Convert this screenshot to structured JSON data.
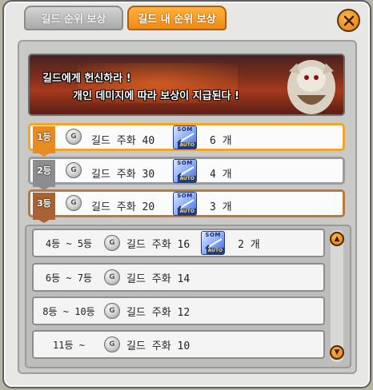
{
  "tabs": [
    {
      "label": "길드 순위 보상",
      "active": false
    },
    {
      "label": "길드 내 순위 보상",
      "active": true
    }
  ],
  "close_icon": "close-icon",
  "banner": {
    "line1": "길드에게 헌신하라 !",
    "line2": "개인 데미지에 따라 보상이 지급된다 !"
  },
  "top_ranks": [
    {
      "rank": "1등",
      "item": "길드 주화 40",
      "ticket_top": "SOM",
      "ticket_auto": "AUTO",
      "count": "6 개",
      "style": "gold"
    },
    {
      "rank": "2등",
      "item": "길드 주화 30",
      "ticket_top": "SOM",
      "ticket_auto": "AUTO",
      "count": "4 개",
      "style": "silver"
    },
    {
      "rank": "3등",
      "item": "길드 주화 20",
      "ticket_top": "SOM",
      "ticket_auto": "AUTO",
      "count": "3 개",
      "style": "bronze"
    }
  ],
  "list_ranks": [
    {
      "rank": "4등 ~ 5등",
      "item": "길드 주화 16",
      "ticket_top": "SOM",
      "ticket_auto": "AUTO",
      "count": "2 개"
    },
    {
      "rank": "6등 ~ 7등",
      "item": "길드 주화 14"
    },
    {
      "rank": "8등 ~ 10등",
      "item": "길드 주화 12"
    },
    {
      "rank": "11등 ~",
      "item": "길드 주화 10"
    }
  ],
  "coin_glyph": "G",
  "scroll": {
    "up_icon": "▲",
    "down_icon": "▼"
  },
  "colors": {
    "accent": "#f08a12",
    "gold": "#f2a52a",
    "silver": "#9b9b9b",
    "bronze": "#b97a3a"
  }
}
